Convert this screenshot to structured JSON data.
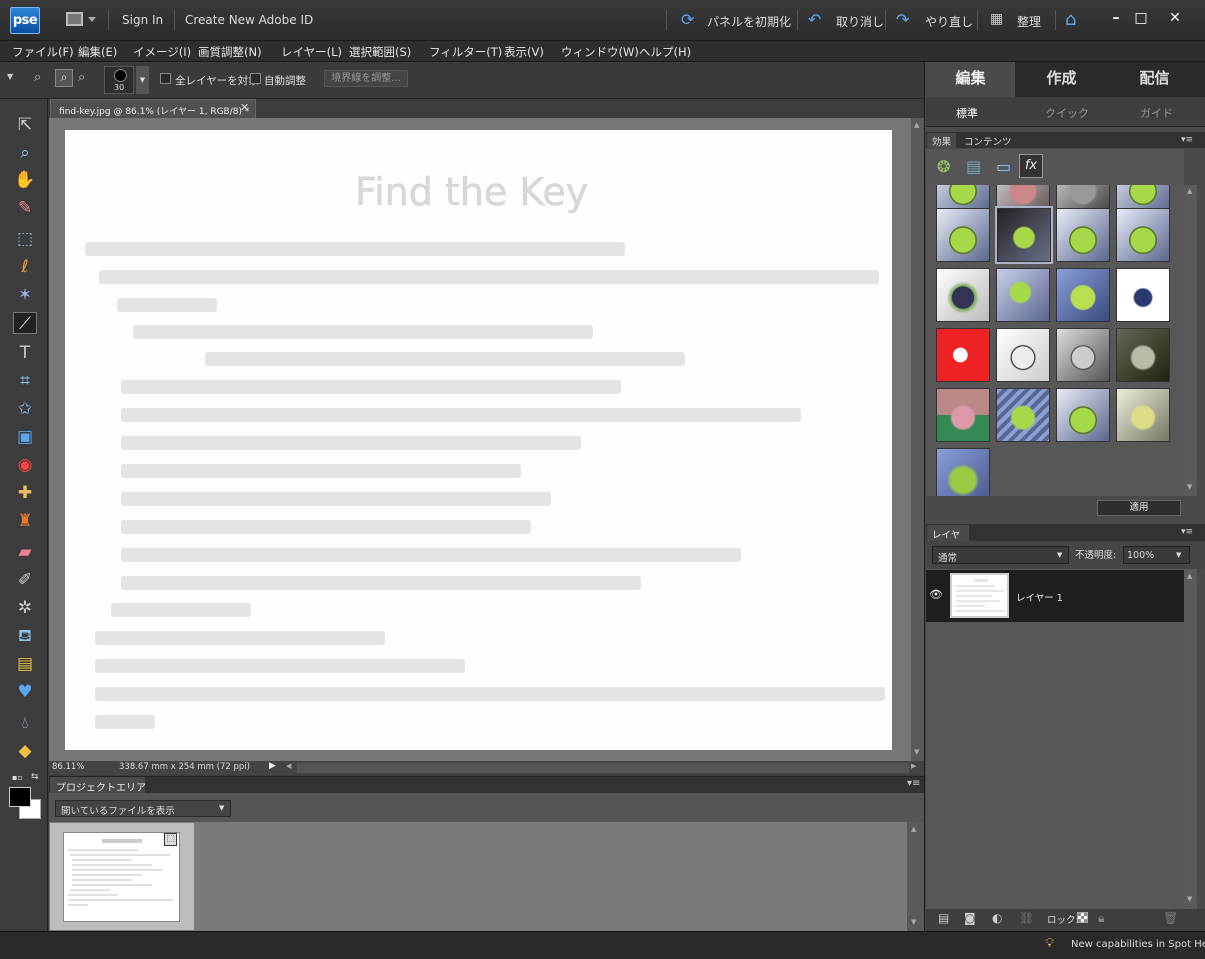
{
  "titlebar": {
    "logo": "pse",
    "sign_in": "Sign In",
    "create_id": "Create New Adobe ID",
    "reset_panels": "パネルを初期化",
    "undo": "取り消し",
    "redo": "やり直し",
    "organize": "整理"
  },
  "menu": [
    "ファイル(F)",
    "編集(E)",
    "イメージ(I)",
    "画質調整(N)",
    "レイヤー(L)",
    "選択範囲(S)",
    "フィルター(T)",
    "表示(V)",
    "ウィンドウ(W)",
    "ヘルプ(H)"
  ],
  "options": {
    "brush_size": "30",
    "sample_all_layers": "全レイヤーを対象",
    "auto_enhance": "自動調整",
    "refine_edge": "境界線を調整..."
  },
  "document": {
    "tab_title": "find-key.jpg @ 86.1% (レイヤー 1, RGB/8) *",
    "zoom": "86.11%",
    "dimensions": "338.67 mm x 254 mm (72 ppi)"
  },
  "project": {
    "tab": "プロジェクトエリア",
    "filter": "開いているファイルを表示"
  },
  "panel": {
    "tabs": [
      "編集",
      "作成",
      "配信"
    ],
    "subtabs": [
      "標準",
      "クイック",
      "ガイド"
    ],
    "fx_tabs": [
      "効果",
      "コンテンツ"
    ],
    "apply": "適用",
    "layers_tab": "レイヤー",
    "blend_mode": "通常",
    "opacity_label": "不透明度:",
    "opacity_value": "100%",
    "layer_name": "レイヤー 1",
    "lock_label": "ロック:"
  },
  "status_tip": "New capabilities in Spot He",
  "colors": {
    "accent_blue": "#3f8fe0",
    "panel_active": "#4a4a4a",
    "canvas": "#ffffff"
  }
}
